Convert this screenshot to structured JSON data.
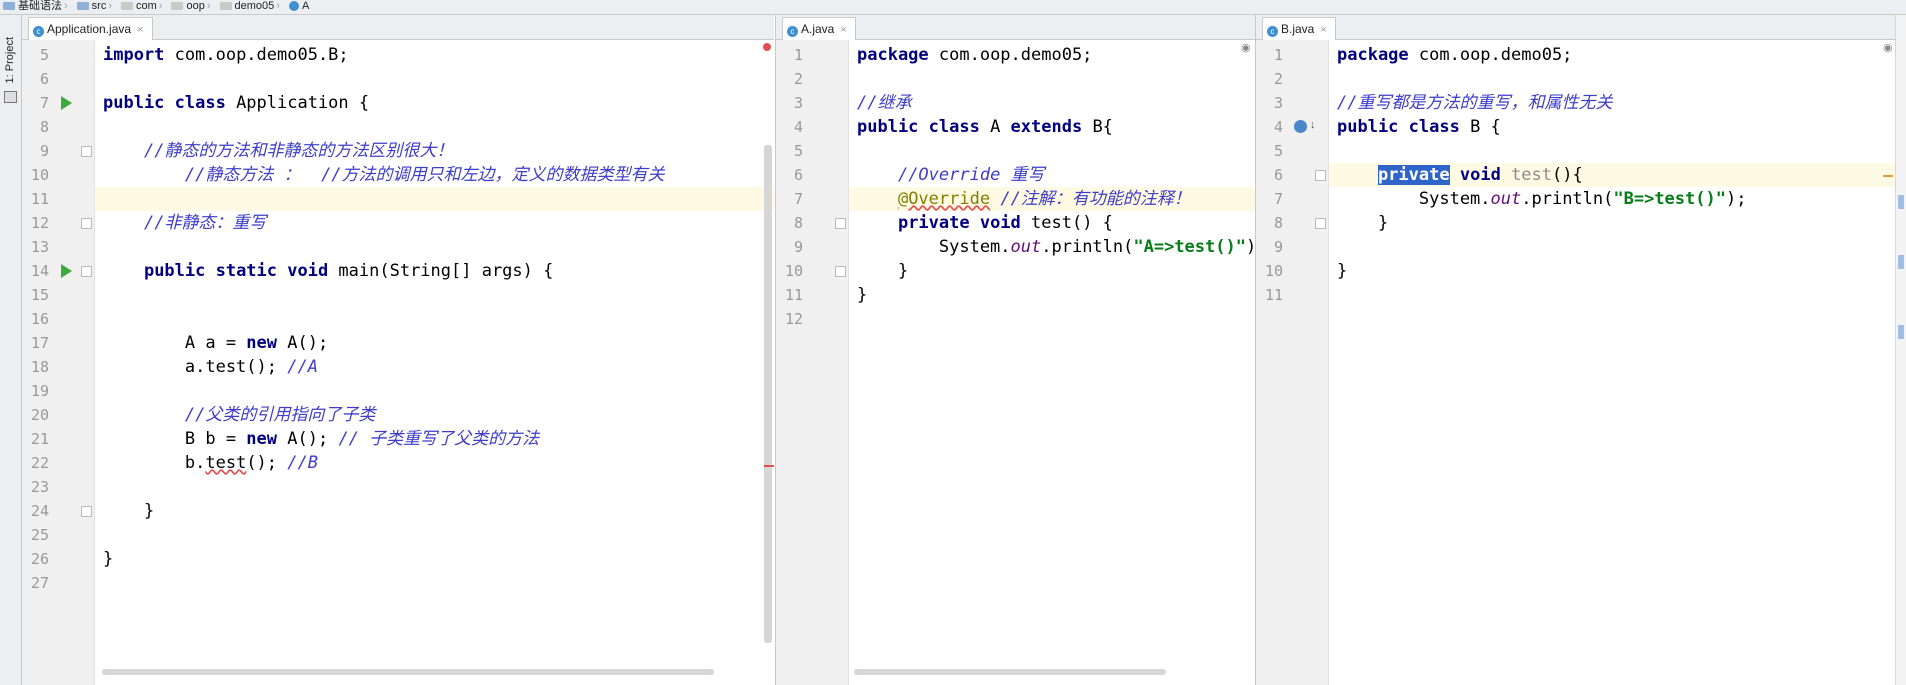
{
  "breadcrumb": [
    "基础语法",
    "src",
    "com",
    "oop",
    "demo05",
    "A"
  ],
  "sidebar": {
    "project_tab": "1: Project"
  },
  "panes": [
    {
      "tab": "Application.java",
      "lines": [
        {
          "n": "5",
          "html": "<span class=\"kw\">import</span> com.oop.demo05.B;"
        },
        {
          "n": "6",
          "html": ""
        },
        {
          "n": "7",
          "html": "<span class=\"kw\">public class</span> Application {"
        },
        {
          "n": "8",
          "html": ""
        },
        {
          "n": "9",
          "html": "    <span class=\"cm\">//静态的方法和非静态的方法区别很大！</span>"
        },
        {
          "n": "10",
          "html": "        <span class=\"cm\">//静态方法 ：  //方法的调用只和左边，定义的数据类型有关</span>"
        },
        {
          "n": "11",
          "html": ""
        },
        {
          "n": "12",
          "html": "    <span class=\"cm\">//非静态：重写</span>"
        },
        {
          "n": "13",
          "html": ""
        },
        {
          "n": "14",
          "html": "    <span class=\"kw\">public static void</span> main(String[] args) {"
        },
        {
          "n": "15",
          "html": ""
        },
        {
          "n": "16",
          "html": ""
        },
        {
          "n": "17",
          "html": "        A a = <span class=\"kw\">new</span> A();"
        },
        {
          "n": "18",
          "html": "        a.test(); <span class=\"cm\">//A</span>"
        },
        {
          "n": "19",
          "html": ""
        },
        {
          "n": "20",
          "html": "        <span class=\"cm\">//父类的引用指向了子类</span>"
        },
        {
          "n": "21",
          "html": "        B b = <span class=\"kw\">new</span> A(); <span class=\"cm\">// 子类重写了父类的方法</span>"
        },
        {
          "n": "22",
          "html": "        b.<span class=\"warn\">test</span>(); <span class=\"cm\">//B</span>"
        },
        {
          "n": "23",
          "html": ""
        },
        {
          "n": "24",
          "html": "    }"
        },
        {
          "n": "25",
          "html": ""
        },
        {
          "n": "26",
          "html": "}"
        },
        {
          "n": "27",
          "html": ""
        }
      ]
    },
    {
      "tab": "A.java",
      "lines": [
        {
          "n": "1",
          "html": "<span class=\"kw\">package</span> com.oop.demo05;"
        },
        {
          "n": "2",
          "html": ""
        },
        {
          "n": "3",
          "html": "<span class=\"cm\">//继承</span>"
        },
        {
          "n": "4",
          "html": "<span class=\"kw\">public class</span> A <span class=\"kw\">extends</span> B{"
        },
        {
          "n": "5",
          "html": ""
        },
        {
          "n": "6",
          "html": "    <span class=\"cm\">//Override 重写</span>"
        },
        {
          "n": "7",
          "html": "    <span class=\"an warn\">@Override</span> <span class=\"cm\">//注解：有功能的注释！</span>"
        },
        {
          "n": "8",
          "html": "    <span class=\"kw\">private void</span> test() {"
        },
        {
          "n": "9",
          "html": "        System.<span class=\"fld\">out</span>.println(<span class=\"str\">\"A=&gt;test()\"</span>);"
        },
        {
          "n": "10",
          "html": "    }"
        },
        {
          "n": "11",
          "html": "}"
        },
        {
          "n": "12",
          "html": ""
        }
      ]
    },
    {
      "tab": "B.java",
      "lines": [
        {
          "n": "1",
          "html": "<span class=\"kw\">package</span> com.oop.demo05;"
        },
        {
          "n": "2",
          "html": ""
        },
        {
          "n": "3",
          "html": "<span class=\"cm\">//重写都是方法的重写，和属性无关</span>"
        },
        {
          "n": "4",
          "html": "<span class=\"kw\">public class</span> B {"
        },
        {
          "n": "5",
          "html": ""
        },
        {
          "n": "6",
          "html": "    <span class=\"kw sel\">private</span> <span class=\"kw\">void</span> <span class=\"unused\">test</span>(){"
        },
        {
          "n": "7",
          "html": "        System.<span class=\"fld\">out</span>.println(<span class=\"str\">\"B=&gt;test()\"</span>);"
        },
        {
          "n": "8",
          "html": "    }"
        },
        {
          "n": "9",
          "html": ""
        },
        {
          "n": "10",
          "html": "}"
        },
        {
          "n": "11",
          "html": ""
        }
      ]
    }
  ]
}
